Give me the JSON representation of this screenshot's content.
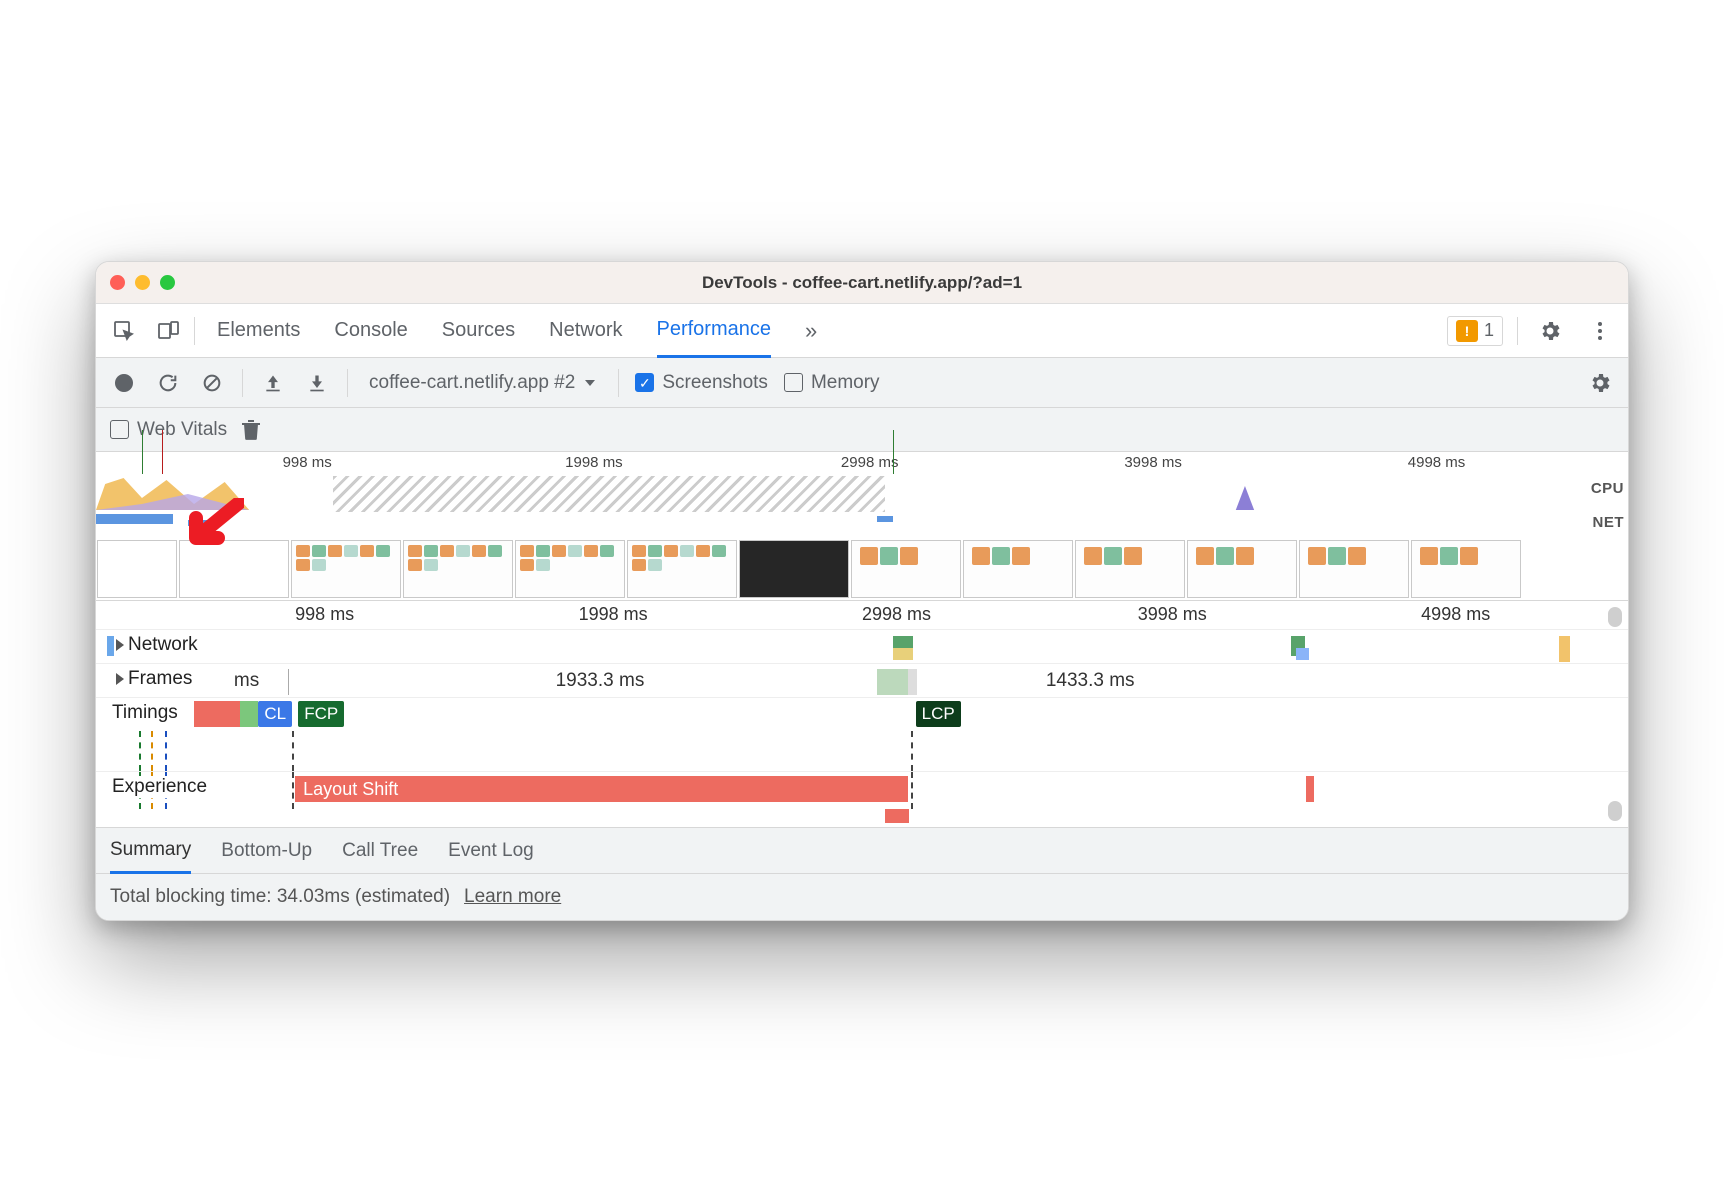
{
  "window": {
    "title": "DevTools - coffee-cart.netlify.app/?ad=1"
  },
  "mainTabs": {
    "items": [
      "Elements",
      "Console",
      "Sources",
      "Network",
      "Performance"
    ],
    "activeIndex": 4,
    "overflowGlyph": "»",
    "issuesCount": "1"
  },
  "toolbar": {
    "profileSelector": "coffee-cart.netlify.app #2",
    "screenshots": {
      "label": "Screenshots",
      "checked": true
    },
    "memory": {
      "label": "Memory",
      "checked": false
    }
  },
  "toolbar2": {
    "webVitals": {
      "label": "Web Vitals",
      "checked": false
    }
  },
  "overview": {
    "ticks": [
      "998 ms",
      "1998 ms",
      "2998 ms",
      "3998 ms",
      "4998 ms"
    ],
    "cpuLabel": "CPU",
    "netLabel": "NET"
  },
  "ruler2": {
    "ticks": [
      "998 ms",
      "1998 ms",
      "2998 ms",
      "3998 ms",
      "4998 ms"
    ]
  },
  "tracks": {
    "network": "Network",
    "frames": "Frames",
    "frameDurations": [
      "1933.3 ms",
      "1433.3 ms"
    ],
    "timings": "Timings",
    "timingPills": {
      "cl": "CL",
      "fcp": "FCP",
      "lcp": "LCP"
    },
    "experience": "Experience",
    "layoutShift": "Layout Shift",
    "msAbbrev": "ms"
  },
  "detail": {
    "tabs": [
      "Summary",
      "Bottom-Up",
      "Call Tree",
      "Event Log"
    ],
    "activeIndex": 0
  },
  "status": {
    "text": "Total blocking time: 34.03ms (estimated)",
    "link": "Learn more"
  }
}
